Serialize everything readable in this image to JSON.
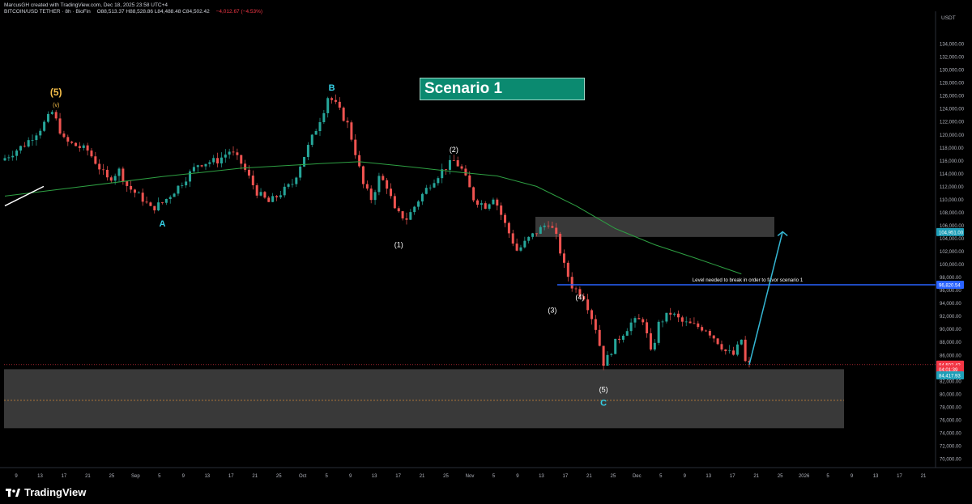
{
  "header": {
    "credit": "MarcusGH created with TradingView.com, Dec 18, 2025 23:58 UTC+4",
    "symbol": "BITCOIN/USD TETHER · 8h · BioFin",
    "ohlc": "O88,513.37 H88,528.86 L84,488.48 C84,502.42",
    "change": "−4,012.67 (−4.53%)"
  },
  "footer": {
    "brand": "TradingView"
  },
  "chart_data": {
    "type": "candlestick",
    "currency": "USDT",
    "ylim": [
      69000,
      137000
    ],
    "y_ticks": [
      "134,000.00",
      "132,000.00",
      "130,000.00",
      "128,000.00",
      "126,000.00",
      "124,000.00",
      "122,000.00",
      "120,000.00",
      "118,000.00",
      "116,000.00",
      "114,000.00",
      "112,000.00",
      "110,000.00",
      "108,000.00",
      "106,000.00",
      "104,000.00",
      "102,000.00",
      "100,000.00",
      "98,000.00",
      "96,000.00",
      "94,000.00",
      "92,000.00",
      "90,000.00",
      "88,000.00",
      "86,000.00",
      "84,000.00",
      "82,000.00",
      "80,000.00",
      "78,000.00",
      "76,000.00",
      "74,000.00",
      "72,000.00",
      "70,000.00"
    ],
    "x_ticks": [
      "9",
      "13",
      "17",
      "21",
      "25",
      "Sep",
      "5",
      "9",
      "13",
      "17",
      "21",
      "25",
      "Oct",
      "5",
      "9",
      "13",
      "17",
      "21",
      "25",
      "Nov",
      "5",
      "9",
      "13",
      "17",
      "21",
      "25",
      "Dec",
      "5",
      "9",
      "13",
      "17",
      "21",
      "25",
      "2026",
      "5",
      "9",
      "13",
      "17",
      "21"
    ],
    "price_path": [
      [
        0,
        116000
      ],
      [
        6,
        118500
      ],
      [
        10,
        121000
      ],
      [
        13,
        123500
      ],
      [
        16,
        119000
      ],
      [
        22,
        117500
      ],
      [
        27,
        113000
      ],
      [
        30,
        114500
      ],
      [
        32,
        112000
      ],
      [
        36,
        110000
      ],
      [
        38,
        108500
      ],
      [
        41,
        109500
      ],
      [
        45,
        112000
      ],
      [
        50,
        115500
      ],
      [
        55,
        116000
      ],
      [
        58,
        117500
      ],
      [
        61,
        115500
      ],
      [
        65,
        111000
      ],
      [
        68,
        109500
      ],
      [
        70,
        110500
      ],
      [
        74,
        112500
      ],
      [
        76,
        115500
      ],
      [
        80,
        121000
      ],
      [
        82,
        124000
      ],
      [
        83,
        126000
      ],
      [
        85,
        124500
      ],
      [
        88,
        121500
      ],
      [
        90,
        117000
      ],
      [
        92,
        112000
      ],
      [
        94,
        110000
      ],
      [
        96,
        113500
      ],
      [
        98,
        112000
      ],
      [
        100,
        108000
      ],
      [
        103,
        107000
      ],
      [
        106,
        110000
      ],
      [
        109,
        112500
      ],
      [
        112,
        114500
      ],
      [
        115,
        116000
      ],
      [
        117,
        114500
      ],
      [
        120,
        110000
      ],
      [
        123,
        109000
      ],
      [
        125,
        110500
      ],
      [
        128,
        106000
      ],
      [
        131,
        102000
      ],
      [
        134,
        104000
      ],
      [
        137,
        105500
      ],
      [
        139,
        106500
      ],
      [
        141,
        104000
      ],
      [
        143,
        99500
      ],
      [
        145,
        96500
      ],
      [
        148,
        95000
      ],
      [
        151,
        90000
      ],
      [
        153,
        84500
      ],
      [
        156,
        88000
      ],
      [
        160,
        91000
      ],
      [
        163,
        91500
      ],
      [
        165,
        86000
      ],
      [
        167,
        91000
      ],
      [
        170,
        92500
      ],
      [
        173,
        91000
      ],
      [
        176,
        90500
      ],
      [
        179,
        90000
      ],
      [
        182,
        88000
      ],
      [
        184,
        86500
      ],
      [
        186,
        86000
      ],
      [
        188,
        88500
      ],
      [
        189,
        84500
      ]
    ],
    "candle_x_range": [
      0,
      189
    ],
    "ma_path": [
      [
        0,
        110500
      ],
      [
        20,
        112000
      ],
      [
        40,
        113500
      ],
      [
        60,
        114800
      ],
      [
        80,
        115500
      ],
      [
        90,
        115800
      ],
      [
        100,
        115200
      ],
      [
        115,
        114200
      ],
      [
        125,
        113600
      ],
      [
        135,
        112000
      ],
      [
        145,
        109000
      ],
      [
        155,
        105500
      ],
      [
        165,
        103000
      ],
      [
        175,
        101000
      ],
      [
        187,
        98500
      ]
    ],
    "annotations": {
      "wave_5_top": "(5)",
      "wave_v": "(v)",
      "wave_A": "A",
      "wave_B": "B",
      "wave_1": "(1)",
      "wave_2": "(2)",
      "wave_3": "(3)",
      "wave_4": "(4)",
      "wave_5_bottom": "(5)",
      "wave_C": "C",
      "scenario": "Scenario 1",
      "level_note": "Level needed to break in order to favor scenario 1"
    },
    "resistance_zone": [
      104200,
      107300
    ],
    "support_zone": [
      74700,
      83800
    ],
    "support_mid_dotted": 79000,
    "break_level": 96820.54,
    "projection": [
      [
        189,
        84500
      ],
      [
        195,
        105000
      ]
    ],
    "price_labels": [
      {
        "text": "104,951.00",
        "value": 104951,
        "color": "#1f9fb8"
      },
      {
        "text": "96,820.54",
        "value": 96820.54,
        "color": "#2962ff"
      },
      {
        "text": "84,502.42",
        "value": 84502.42,
        "color": "#f23645"
      },
      {
        "text": "04:01:39",
        "value": 83800,
        "color": "#f23645"
      },
      {
        "text": "84,417.93",
        "value": 82850,
        "color": "#1f9fb8"
      }
    ],
    "colors": {
      "up": "#26a69a",
      "down": "#ef5350",
      "ma": "#2ea043",
      "zone": "#434343",
      "break_line": "#2962ff",
      "projection": "#35b7d4",
      "wave_top": "#f7c04a",
      "wave_cyan": "#35d0e6"
    }
  }
}
